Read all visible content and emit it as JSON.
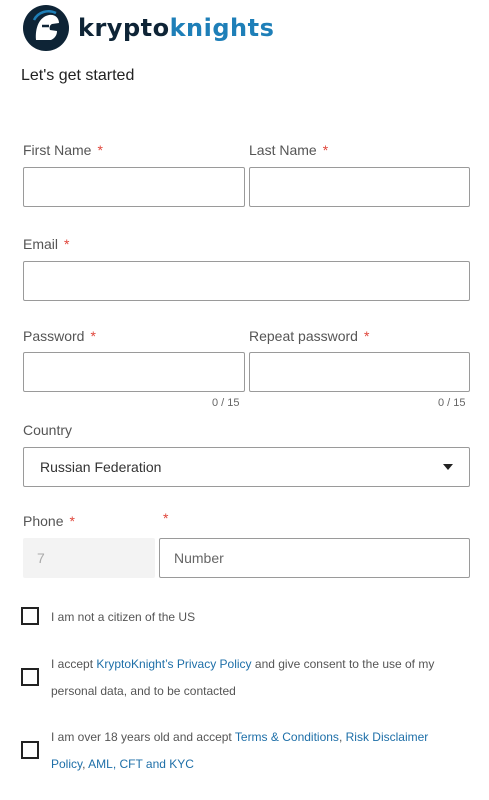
{
  "brand": {
    "name_dark": "krypto",
    "name_accent": "knights"
  },
  "heading": "Let's get started",
  "form": {
    "first_name_label": "First Name",
    "last_name_label": "Last Name",
    "email_label": "Email",
    "password_label": "Password",
    "repeat_password_label": "Repeat password",
    "password_counter": "0 / 15",
    "repeat_password_counter": "0 / 15",
    "country_label": "Country",
    "country_value": "Russian Federation",
    "phone_label": "Phone",
    "phone_code": "7",
    "phone_number_placeholder": "Number",
    "required_mark": "*"
  },
  "consents": {
    "not_us_citizen": "I am not a citizen of the US",
    "privacy_prefix": "I accept ",
    "privacy_link": "KryptoKnight’s Privacy Policy",
    "privacy_suffix_line1": " give consent to the use of my",
    "privacy_and": "and",
    "privacy_line2": "personal data, and to be contacted",
    "age_prefix": "I am over 18 years old and accept ",
    "terms_link": "Terms & Conditions",
    "comma": ", ",
    "risk_link_part1": "Risk Disclaimer",
    "risk_link_part2": "Policy",
    "aml_link": "AML, CFT and KYC"
  },
  "colors": {
    "accent": "#1e7fb8",
    "brand_dark": "#0e2436",
    "required": "#e0453a"
  }
}
